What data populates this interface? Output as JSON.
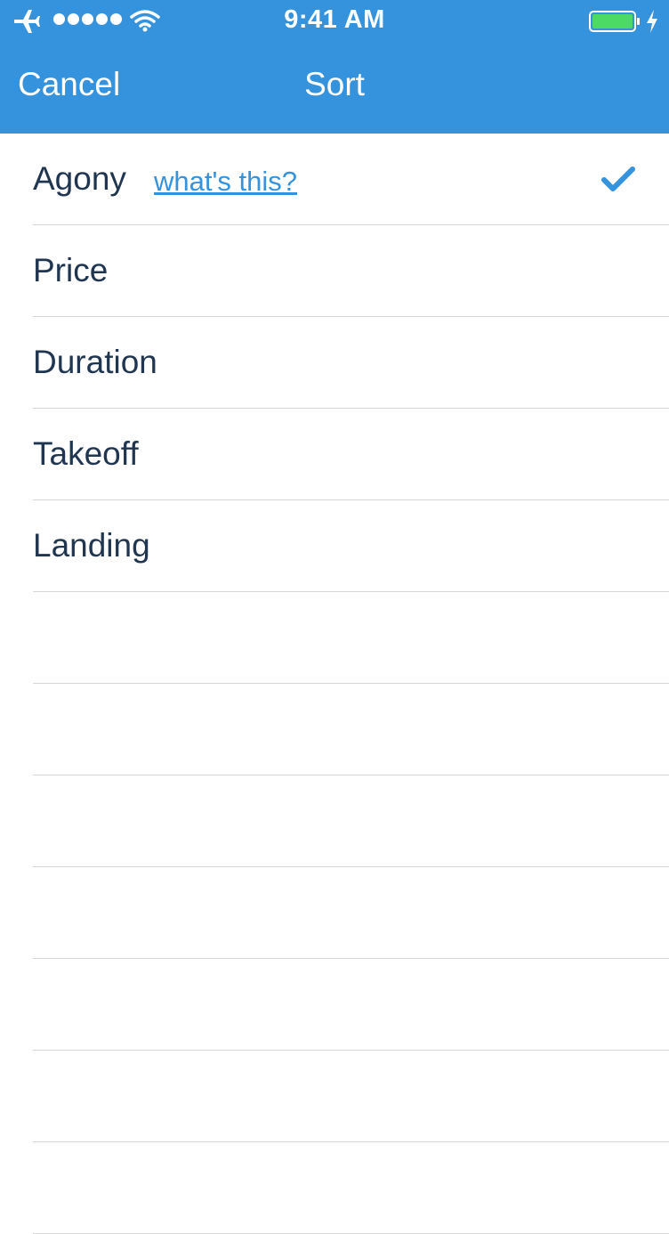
{
  "status_bar": {
    "time": "9:41 AM",
    "signal_dots": 5,
    "icons": [
      "airplane-icon",
      "wifi-icon",
      "battery-icon",
      "bolt-icon"
    ],
    "battery_level": 1.0
  },
  "nav": {
    "cancel_label": "Cancel",
    "title": "Sort"
  },
  "sort_options": [
    {
      "label": "Agony",
      "link": "what's this?",
      "selected": true
    },
    {
      "label": "Price"
    },
    {
      "label": "Duration"
    },
    {
      "label": "Takeoff"
    },
    {
      "label": "Landing"
    }
  ],
  "colors": {
    "accent": "#3592dc",
    "text": "#1f3550",
    "separator": "#d6d6d6",
    "battery": "#4cd964"
  }
}
